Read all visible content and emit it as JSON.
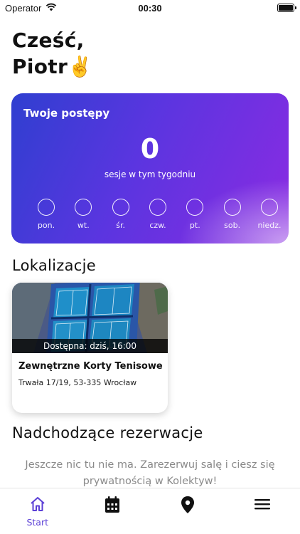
{
  "status_bar": {
    "carrier": "Operator",
    "time": "00:30"
  },
  "greeting": {
    "line1": "Cześć,",
    "line2": "Piotr✌️"
  },
  "progress": {
    "title": "Twoje postępy",
    "sessions_count": "0",
    "sessions_label": "sesje w tym tygodniu",
    "days": [
      "pon.",
      "wt.",
      "śr.",
      "czw.",
      "pt.",
      "sob.",
      "niedz."
    ]
  },
  "locations": {
    "title": "Lokalizacje",
    "items": [
      {
        "availability": "Dostępna: dziś, 16:00",
        "name": "Zewnętrzne Korty Tenisowe",
        "address": "Trwała 17/19, 53-335 Wrocław"
      }
    ]
  },
  "reservations": {
    "title": "Nadchodzące rezerwacje",
    "empty_message": "Jeszcze nic tu nie ma. Zarezerwuj salę i ciesz się prywatnością w Kolektyw!"
  },
  "tab_bar": {
    "start_label": "Start"
  },
  "colors": {
    "accent": "#5b3fd6",
    "card_gradient_start": "#2f3fd0",
    "card_gradient_end": "#8a2be2"
  }
}
